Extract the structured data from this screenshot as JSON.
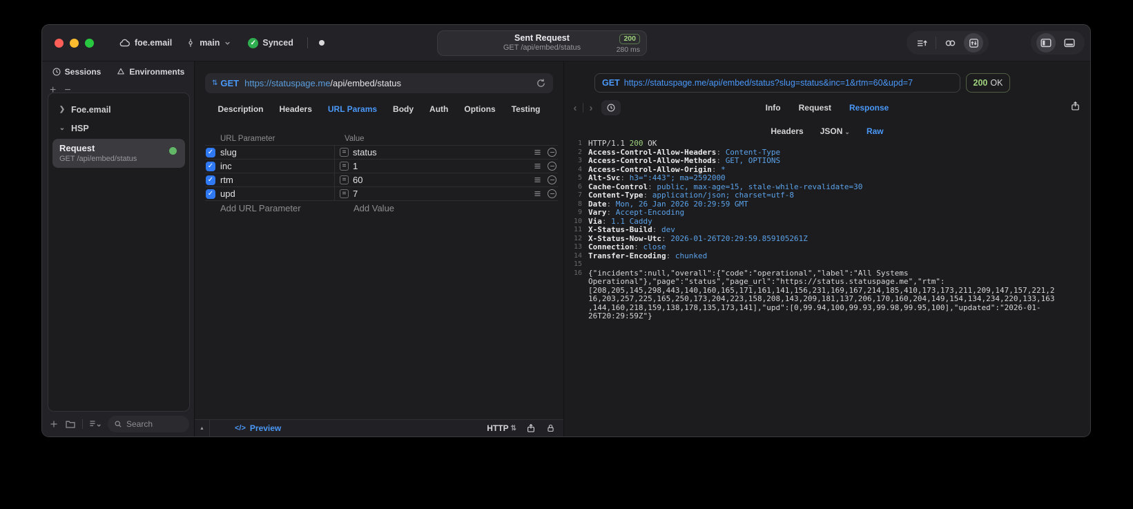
{
  "colors": {
    "accent_blue": "#4a98f8",
    "status_green": "#9fd37d",
    "checkbox_blue": "#2f7af2"
  },
  "titlebar": {
    "project": "foe.email",
    "branch": "main",
    "sync_label": "Synced",
    "request_title": "Sent Request",
    "request_subtitle": "GET /api/embed/status",
    "status_code": "200",
    "response_time": "280 ms"
  },
  "sidebar": {
    "tab_sessions": "Sessions",
    "tab_environments": "Environments",
    "plus": "+",
    "minus": "−",
    "tree_item_1": "Foe.email",
    "tree_item_2": "HSP",
    "request_name": "Request",
    "request_subtitle": "GET /api/embed/status",
    "search_placeholder": "Search"
  },
  "request_panel": {
    "method": "GET",
    "url_host": "https://statuspage.me",
    "url_path": "/api/embed/status",
    "tabs": [
      "Description",
      "Headers",
      "URL Params",
      "Body",
      "Auth",
      "Options",
      "Testing"
    ],
    "active_tab": "URL Params",
    "table": {
      "col_name": "URL Parameter",
      "col_value": "Value",
      "rows": [
        {
          "name": "slug",
          "value": "status",
          "enabled": true
        },
        {
          "name": "inc",
          "value": "1",
          "enabled": true
        },
        {
          "name": "rtm",
          "value": "60",
          "enabled": true
        },
        {
          "name": "upd",
          "value": "7",
          "enabled": true
        }
      ],
      "add_name": "Add URL Parameter",
      "add_value": "Add Value"
    },
    "footer": {
      "code_glyph": "</>",
      "preview": "Preview",
      "protocol": "HTTP"
    }
  },
  "response_panel": {
    "method": "GET",
    "url": "https://statuspage.me/api/embed/status?slug=status&inc=1&rtm=60&upd=7",
    "status_code": "200",
    "status_text": "OK",
    "tabs": [
      "Info",
      "Request",
      "Response"
    ],
    "active_tab": "Response",
    "subtabs": [
      "Headers",
      "JSON",
      "Raw"
    ],
    "active_subtab": "Raw",
    "lines": [
      {
        "num": 1,
        "parts": [
          [
            "HTTP/1.1 ",
            "p"
          ],
          [
            "200",
            "g"
          ],
          [
            " OK",
            "p"
          ]
        ]
      },
      {
        "num": 2,
        "parts": [
          [
            "Access-Control-Allow-Headers",
            "h"
          ],
          [
            ": ",
            "s"
          ],
          [
            "Content-Type",
            "v"
          ]
        ]
      },
      {
        "num": 3,
        "parts": [
          [
            "Access-Control-Allow-Methods",
            "h"
          ],
          [
            ": ",
            "s"
          ],
          [
            "GET, OPTIONS",
            "v"
          ]
        ]
      },
      {
        "num": 4,
        "parts": [
          [
            "Access-Control-Allow-Origin",
            "h"
          ],
          [
            ": ",
            "s"
          ],
          [
            "*",
            "v"
          ]
        ]
      },
      {
        "num": 5,
        "parts": [
          [
            "Alt-Svc",
            "h"
          ],
          [
            ": ",
            "s"
          ],
          [
            "h3=\":443\"; ma=2592000",
            "v"
          ]
        ]
      },
      {
        "num": 6,
        "parts": [
          [
            "Cache-Control",
            "h"
          ],
          [
            ": ",
            "s"
          ],
          [
            "public, max-age=15, stale-while-revalidate=30",
            "v"
          ]
        ]
      },
      {
        "num": 7,
        "parts": [
          [
            "Content-Type",
            "h"
          ],
          [
            ": ",
            "s"
          ],
          [
            "application/json; charset=utf-8",
            "v"
          ]
        ]
      },
      {
        "num": 8,
        "parts": [
          [
            "Date",
            "h"
          ],
          [
            ": ",
            "s"
          ],
          [
            "Mon, 26 Jan 2026 20:29:59 GMT",
            "v"
          ]
        ]
      },
      {
        "num": 9,
        "parts": [
          [
            "Vary",
            "h"
          ],
          [
            ": ",
            "s"
          ],
          [
            "Accept-Encoding",
            "v"
          ]
        ]
      },
      {
        "num": 10,
        "parts": [
          [
            "Via",
            "h"
          ],
          [
            ": ",
            "s"
          ],
          [
            "1.1 Caddy",
            "v"
          ]
        ]
      },
      {
        "num": 11,
        "parts": [
          [
            "X-Status-Build",
            "h"
          ],
          [
            ": ",
            "s"
          ],
          [
            "dev",
            "v"
          ]
        ]
      },
      {
        "num": 12,
        "parts": [
          [
            "X-Status-Now-Utc",
            "h"
          ],
          [
            ": ",
            "s"
          ],
          [
            "2026-01-26T20:29:59.859105261Z",
            "v"
          ]
        ]
      },
      {
        "num": 13,
        "parts": [
          [
            "Connection",
            "h"
          ],
          [
            ": ",
            "s"
          ],
          [
            "close",
            "v"
          ]
        ]
      },
      {
        "num": 14,
        "parts": [
          [
            "Transfer-Encoding",
            "h"
          ],
          [
            ": ",
            "s"
          ],
          [
            "chunked",
            "v"
          ]
        ]
      },
      {
        "num": 15,
        "parts": []
      },
      {
        "num": 16,
        "parts": [
          [
            "{\"incidents\":null,\"overall\":{\"code\":\"operational\",\"label\":\"All Systems Operational\"},\"page\":\"status\",\"page_url\":\"https://status.statuspage.me\",\"rtm\":[208,205,145,298,443,140,160,165,171,161,141,156,231,169,167,214,185,410,173,173,211,209,147,157,221,216,203,257,225,165,250,173,204,223,158,208,143,209,181,137,206,170,160,204,149,154,134,234,220,133,163,144,160,218,159,138,178,135,173,141],\"upd\":[0,99.94,100,99.93,99.98,99.95,100],\"updated\":\"2026-01-26T20:29:59Z\"}",
            "p"
          ]
        ]
      }
    ]
  }
}
